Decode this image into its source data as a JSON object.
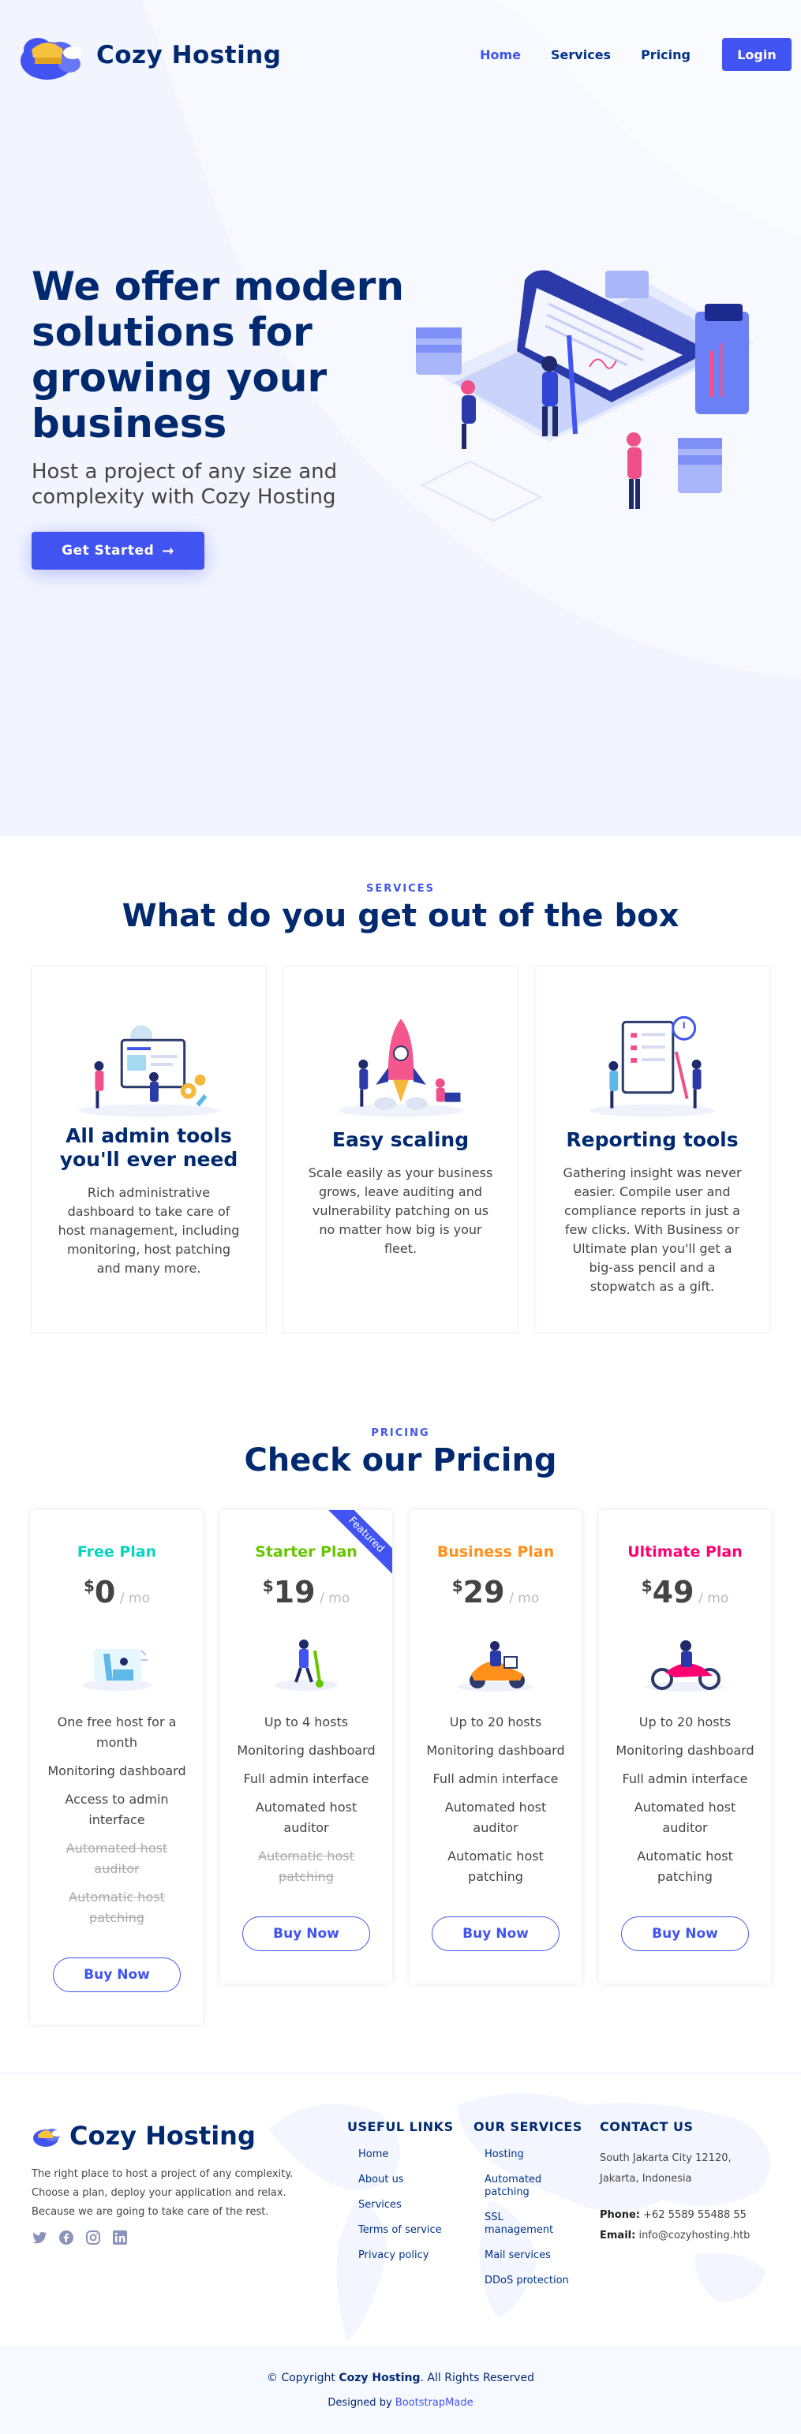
{
  "header": {
    "brand": "Cozy Hosting",
    "nav": [
      "Home",
      "Services",
      "Pricing"
    ],
    "login": "Login"
  },
  "hero": {
    "title": "We offer modern solutions for growing your business",
    "subtitle": "Host a project of any size and complexity with Cozy Hosting",
    "cta": "Get Started",
    "cta_icon": "arrow-right-icon"
  },
  "services": {
    "tag": "SERVICES",
    "title": "What do you get out of the box",
    "cards": [
      {
        "title": "All admin tools you'll ever need",
        "text": "Rich administrative dashboard to take care of host management, including monitoring, host patching and many more."
      },
      {
        "title": "Easy scaling",
        "text": "Scale easily as your business grows, leave auditing and vulnerability patching on us no matter how big is your fleet."
      },
      {
        "title": "Reporting tools",
        "text": "Gathering insight was never easier. Compile user and compliance reports in just a few clicks. With Business or Ultimate plan you'll get a big-ass pencil and a stopwatch as a gift."
      }
    ]
  },
  "pricing": {
    "tag": "PRICING",
    "title": "Check our Pricing",
    "currency": "$",
    "period": "/ mo",
    "ribbon": "Featured",
    "buy": "Buy Now",
    "plans": [
      {
        "name": "Free Plan",
        "color": "#07d5c0",
        "price": "0",
        "features": [
          "One free host for a month",
          "Monitoring dashboard",
          "Access to admin interface",
          "Automated host auditor",
          "Automatic host patching"
        ],
        "na": [
          3,
          4
        ]
      },
      {
        "name": "Starter Plan",
        "color": "#65c600",
        "price": "19",
        "features": [
          "Up to 4 hosts",
          "Monitoring dashboard",
          "Full admin interface",
          "Automated host auditor",
          "Automatic host patching"
        ],
        "na": [
          4
        ]
      },
      {
        "name": "Business Plan",
        "color": "#ff901c",
        "price": "29",
        "features": [
          "Up to 20 hosts",
          "Monitoring dashboard",
          "Full admin interface",
          "Automated host auditor",
          "Automatic host patching"
        ],
        "na": []
      },
      {
        "name": "Ultimate Plan",
        "color": "#ff0071",
        "price": "49",
        "features": [
          "Up to 20 hosts",
          "Monitoring dashboard",
          "Full admin interface",
          "Automated host auditor",
          "Automatic host patching"
        ],
        "na": []
      }
    ]
  },
  "footer": {
    "brand": "Cozy Hosting",
    "about": "The right place to host a project of any complexity. Choose a plan, deploy your application and relax. Because we are going to take care of the rest.",
    "social": [
      "twitter-icon",
      "facebook-icon",
      "instagram-icon",
      "linkedin-icon"
    ],
    "useful_links": {
      "title": "USEFUL LINKS",
      "items": [
        "Home",
        "About us",
        "Services",
        "Terms of service",
        "Privacy policy"
      ]
    },
    "our_services": {
      "title": "OUR SERVICES",
      "items": [
        "Hosting",
        "Automated patching",
        "SSL management",
        "Mail services",
        "DDoS protection"
      ]
    },
    "contact": {
      "title": "CONTACT US",
      "address_line1": "South Jakarta City 12120,",
      "address_line2": "Jakarta, Indonesia",
      "phone_label": "Phone:",
      "phone": "+62 5589 55488 55",
      "email_label": "Email:",
      "email": "info@cozyhosting.htb"
    },
    "copyright_prefix": "© Copyright",
    "copyright_brand": "Cozy Hosting",
    "copyright_suffix": ". All Rights Reserved",
    "designed_by_prefix": "Designed by",
    "designed_by_link": "BootstrapMade"
  },
  "colors": {
    "accent": "#4154f1",
    "navy": "#012970",
    "hero_bg": "#f3f5fe"
  }
}
